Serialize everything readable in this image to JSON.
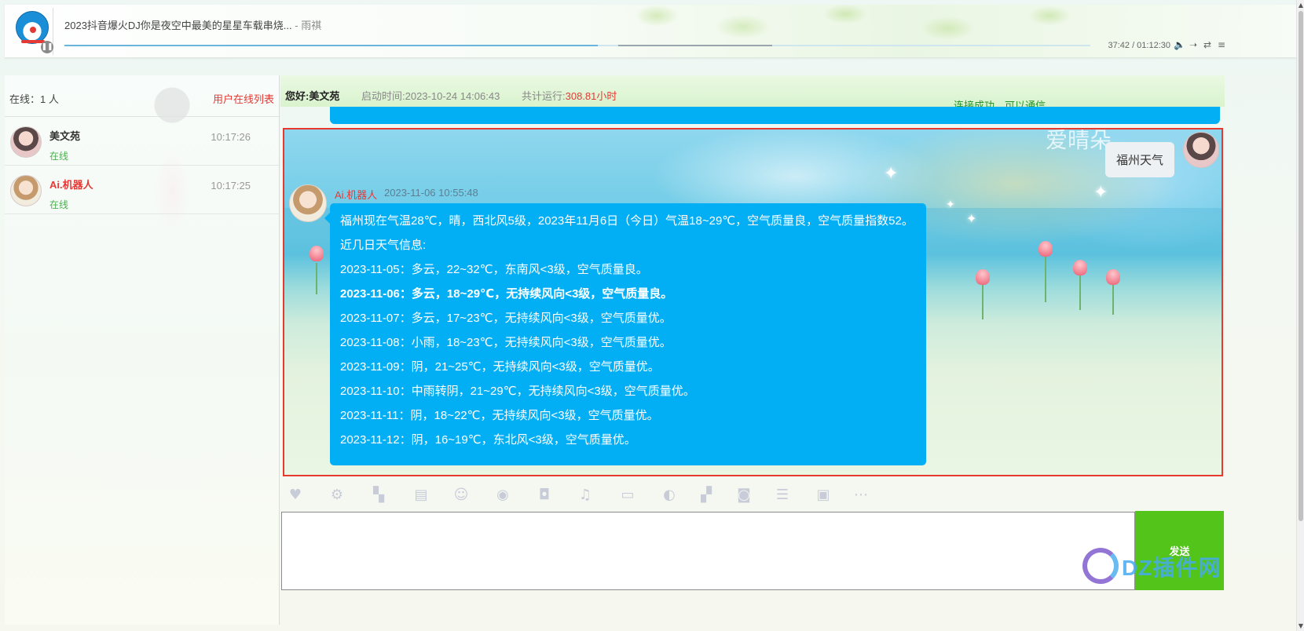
{
  "music": {
    "title": "2023抖音爆火DJ你是夜空中最美的星星车载串烧...",
    "artist": " - 雨祺",
    "time": "37:42 / 01:12:30",
    "progress": 0.52
  },
  "sidebar": {
    "online_count": "在线：1 人",
    "online_list_link": "用户在线列表",
    "users": [
      {
        "name": "美文苑",
        "status": "在线",
        "time": "10:17:26"
      },
      {
        "name": "Ai.机器人",
        "status": "在线",
        "time": "10:17:25"
      }
    ]
  },
  "header": {
    "hello": "您好:美文苑",
    "start_time": "启动时间:2023-10-24 14:06:43",
    "run_label": "共计运行:",
    "run_value": "308.81小时",
    "connection": "连接成功，可以通信"
  },
  "chat": {
    "outgoing": "福州天气",
    "bot_name": "Ai.机器人",
    "bot_time": "2023-11-06 10:55:48",
    "bot_lines": [
      "福州现在气温28℃，晴，西北风5级，2023年11月6日（今日）气温18~29℃，空气质量良，空气质量指数52。",
      "近几日天气信息:",
      "2023-11-05：多云，22~32℃，东南风<3级，空气质量良。",
      "2023-11-06：多云，18~29℃，无持续风向<3级，空气质量良。",
      "2023-11-07：多云，17~23℃，无持续风向<3级，空气质量优。",
      "2023-11-08：小雨，18~23℃，无持续风向<3级，空气质量优。",
      "2023-11-09：阴，21~25℃，无持续风向<3级，空气质量优。",
      "2023-11-10：中雨转阴，21~29℃，无持续风向<3级，空气质量优。",
      "2023-11-11：阴，18~22℃，无持续风向<3级，空气质量优。",
      "2023-11-12：阴，16~19℃，东北风<3级，空气质量优。"
    ]
  },
  "toolbar": {
    "icons": [
      "heart-icon",
      "gear-icon",
      "map-icon",
      "contact-card-icon",
      "smiley-icon",
      "user-circle-icon",
      "camera-icon",
      "music-icon",
      "folder-icon",
      "toggle-icon",
      "checker-icon",
      "rss-icon",
      "list-icon",
      "trash-icon",
      "more-icon"
    ]
  },
  "input": {
    "placeholder": "",
    "value": ""
  },
  "send_label": "发送",
  "watermark": "DZ插件网",
  "colors": {
    "accent": "#02aff5",
    "send": "#52c41a",
    "red": "#e53935",
    "online": "#4caf50"
  }
}
